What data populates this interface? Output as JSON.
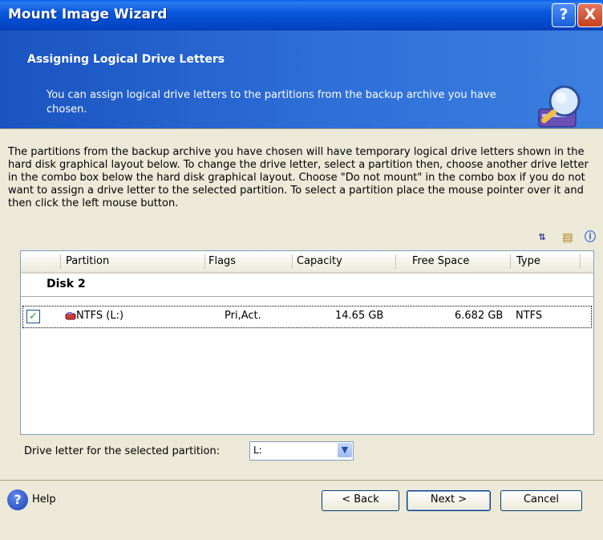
{
  "window": {
    "title": "Mount Image Wizard",
    "help_btn": "?",
    "close_btn": "X"
  },
  "header": {
    "title": "Assigning Logical Drive Letters",
    "desc": "You can assign logical drive letters to the partitions from the backup archive you have chosen."
  },
  "intro": "The partitions from the backup archive you have chosen will have temporary logical drive letters shown in the hard disk graphical layout below. To change the drive letter, select a partition then, choose another drive letter in the combo box below the hard disk graphical layout. Choose \"Do not mount\" in the combo box if you do not want to assign a drive letter to the selected partition. To select a partition place the mouse pointer over it and then click the left mouse button.",
  "table": {
    "columns": [
      "Partition",
      "Flags",
      "Capacity",
      "Free Space",
      "Type"
    ],
    "disk": "Disk 2",
    "row": {
      "checked": "✓",
      "partition": "NTFS (L:)",
      "flags": "Pri,Act.",
      "capacity": "14.65 GB",
      "free": "6.682 GB",
      "type": "NTFS"
    }
  },
  "drive": {
    "label": "Drive letter for the selected partition:",
    "value": "L:"
  },
  "buttons": {
    "help": "Help",
    "back": "< Back",
    "next": "Next >",
    "cancel": "Cancel"
  },
  "icons": [
    "sort-icon",
    "properties-icon",
    "info-icon"
  ],
  "colors": {
    "titlebar": "#0a58dc",
    "header": "#2e6fd8",
    "face": "#ece9d8"
  }
}
